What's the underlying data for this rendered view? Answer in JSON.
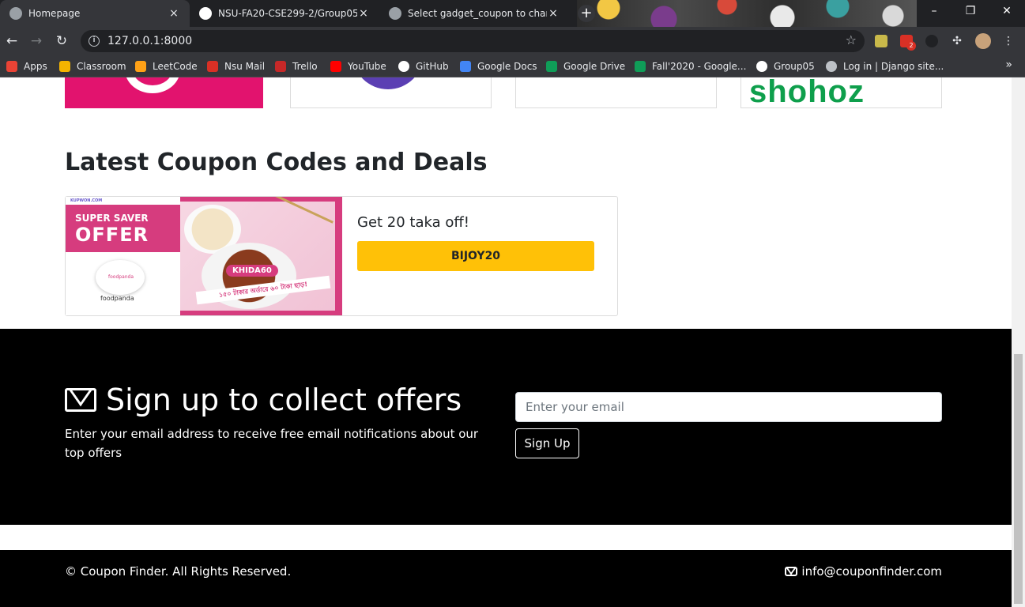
{
  "browser": {
    "tabs": [
      {
        "title": "Homepage",
        "close": "×"
      },
      {
        "title": "NSU-FA20-CSE299-2/Group05: ",
        "close": "×"
      },
      {
        "title": "Select gadget_coupon to change",
        "close": "×"
      }
    ],
    "new_tab": "+",
    "window_buttons": {
      "minimize": "–",
      "restore": "❐",
      "close": "✕"
    },
    "url": "127.0.0.1:8000",
    "extensions": {
      "mail_badge": "2"
    },
    "bookmarks": [
      {
        "label": "Apps",
        "color": "#ea4335"
      },
      {
        "label": "Classroom",
        "color": "#f4b400"
      },
      {
        "label": "LeetCode",
        "color": "#ffa116"
      },
      {
        "label": "Nsu Mail",
        "color": "#d93025"
      },
      {
        "label": "Trello",
        "color": "#c62828"
      },
      {
        "label": "YouTube",
        "color": "#ff0000"
      },
      {
        "label": "GitHub",
        "color": "#ffffff"
      },
      {
        "label": "Google Docs",
        "color": "#4285f4"
      },
      {
        "label": "Google Drive",
        "color": "#0f9d58"
      },
      {
        "label": "Fall'2020 - Google...",
        "color": "#0f9d58"
      },
      {
        "label": "Group05",
        "color": "#ffffff"
      },
      {
        "label": "Log in | Django site...",
        "color": "#bdc1c6"
      }
    ],
    "bookmarks_more": "»"
  },
  "stores": {
    "shohoz_text": "shohoz"
  },
  "latest": {
    "heading": "Latest Coupon Codes and Deals",
    "coupon": {
      "image": {
        "brand_small": "KUPWON.COM",
        "super_saver": "SUPER SAVER",
        "offer": "OFFER",
        "foodpanda_mini": "foodpanda",
        "foodpanda": "foodpanda",
        "code_badge": "KHIDA60",
        "bangla_text": "১৫০ টাকার অর্ডারে ৬০ টাকা ছাড়!"
      },
      "title": "Get 20 taka off!",
      "code": "BIJOY20"
    }
  },
  "signup": {
    "heading": "Sign up to collect offers",
    "description": "Enter your email address to receive free email notifications about our top offers",
    "email_placeholder": "Enter your email",
    "button": "Sign Up"
  },
  "footer": {
    "copyright": "© Coupon Finder. All Rights Reserved.",
    "email": "info@couponfinder.com"
  },
  "colors": {
    "accent_yellow": "#ffc107",
    "bkash_pink": "#e2136e",
    "foodpanda_pink": "#d63c7e",
    "shohoz_green": "#0e9f4c"
  }
}
